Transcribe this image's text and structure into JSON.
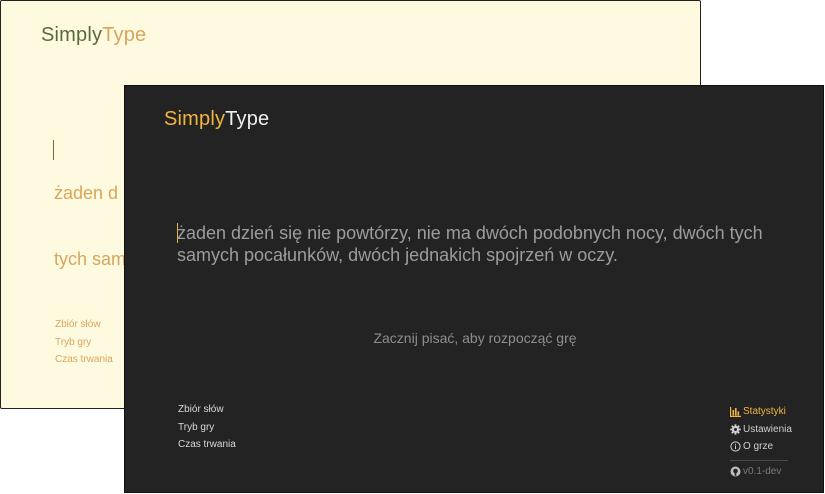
{
  "light_window": {
    "logo_part1": "Simply",
    "logo_part2": "Type",
    "text_line1": "żaden d",
    "text_line2": "tych sam",
    "menu": [
      "Zbiór słów",
      "Tryb gry",
      "Czas trwania"
    ]
  },
  "dark_window": {
    "logo_part1": "Simply",
    "logo_part2": "Type",
    "text": "żaden dzień się nie powtórzy, nie ma dwóch podobnych nocy, dwóch tych samych pocałunków, dwóch jednakich spojrzeń w oczy.",
    "hint": "Zacznij pisać, aby rozpocząć grę",
    "menu": [
      "Zbiór słów",
      "Tryb gry",
      "Czas trwania"
    ],
    "links": {
      "stats": "Statystyki",
      "settings": "Ustawienia",
      "about": "O grze",
      "version": "v0.1-dev"
    }
  },
  "icons": [
    "stats-icon",
    "gear-icon",
    "info-icon",
    "github-icon"
  ],
  "colors": {
    "light_bg": "#fefadf",
    "dark_bg": "#232323",
    "accent": "#f2b53d",
    "light_accent": "#d8a55c"
  }
}
